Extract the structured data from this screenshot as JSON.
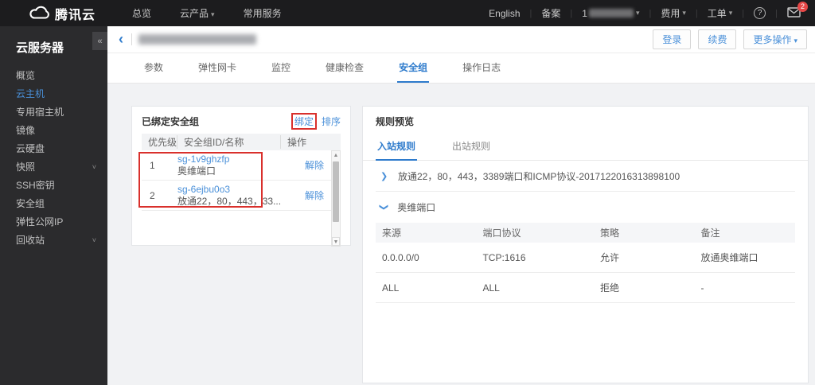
{
  "colors": {
    "accent_blue": "#2e7bcc",
    "link_blue": "#4a90d9",
    "annotation_red": "#d9302c",
    "badge_red": "#e64747",
    "topbar_bg": "#1c1c1e",
    "sidebar_bg": "#2b2b2d"
  },
  "icons": {
    "logo": "cloud-icon",
    "caret_down": "▾",
    "collapse": "«",
    "back": "‹",
    "chevron": "❯",
    "help": "?",
    "scroll_up": "▲",
    "scroll_down": "▼",
    "separator": "|"
  },
  "topbar": {
    "logo_text": "腾讯云",
    "nav": [
      {
        "label": "总览"
      },
      {
        "label": "云产品"
      },
      {
        "label": "常用服务"
      }
    ],
    "right": {
      "english": "English",
      "beian": "备案",
      "account_prefix": "1",
      "fee": "费用",
      "ticket": "工单",
      "badge_count": "2"
    }
  },
  "sidebar": {
    "title": "云服务器",
    "items": [
      {
        "label": "概览"
      },
      {
        "label": "云主机"
      },
      {
        "label": "专用宿主机"
      },
      {
        "label": "镜像"
      },
      {
        "label": "云硬盘"
      },
      {
        "label": "快照"
      },
      {
        "label": "SSH密钥"
      },
      {
        "label": "安全组"
      },
      {
        "label": "弹性公网IP"
      },
      {
        "label": "回收站"
      }
    ]
  },
  "detail_header": {
    "buttons": [
      {
        "label": "登录"
      },
      {
        "label": "续费"
      },
      {
        "label": "更多操作"
      }
    ]
  },
  "detail_tabs": [
    {
      "label": "参数"
    },
    {
      "label": "弹性网卡"
    },
    {
      "label": "监控"
    },
    {
      "label": "健康检查"
    },
    {
      "label": "安全组"
    },
    {
      "label": "操作日志"
    }
  ],
  "bound_panel": {
    "title": "已绑定安全组",
    "bind_link": "绑定",
    "sort_link": "排序",
    "columns": [
      "优先级",
      "安全组ID/名称",
      "操作"
    ],
    "rows": [
      {
        "priority": "1",
        "sg_id": "sg-1v9ghzfp",
        "sg_name": "奥维端口",
        "action": "解除"
      },
      {
        "priority": "2",
        "sg_id": "sg-6ejbu0o3",
        "sg_name": "放通22，80，443，33...",
        "action": "解除"
      }
    ]
  },
  "rules_panel": {
    "title": "规则预览",
    "tabs": [
      {
        "label": "入站规则"
      },
      {
        "label": "出站规则"
      }
    ],
    "groups": [
      {
        "name": "放通22，80，443，3389端口和ICMP协议-2017122016313898100"
      },
      {
        "name": "奥维端口"
      }
    ],
    "table": {
      "columns": [
        "来源",
        "端口协议",
        "策略",
        "备注"
      ],
      "rows": [
        {
          "source": "0.0.0.0/0",
          "port": "TCP:1616",
          "policy": "允许",
          "note": "放通奥维端口"
        },
        {
          "source": "ALL",
          "port": "ALL",
          "policy": "拒绝",
          "note": "-"
        }
      ]
    }
  }
}
